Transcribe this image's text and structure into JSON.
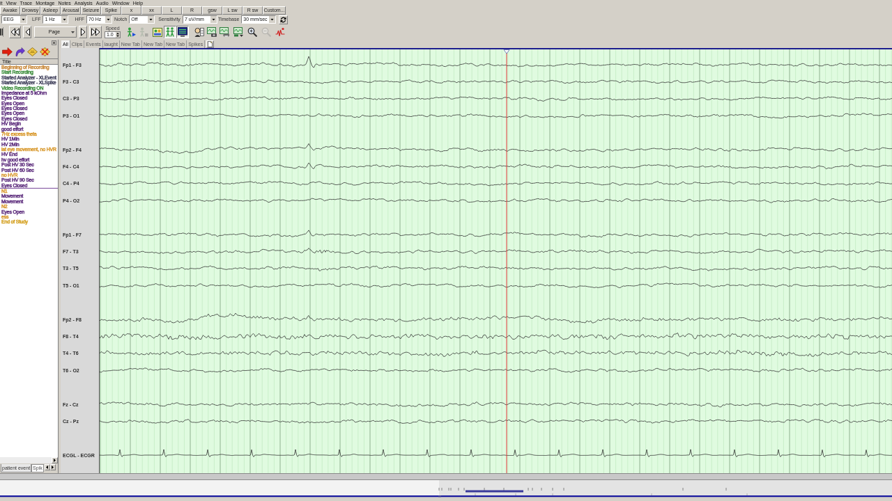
{
  "menu": [
    "it",
    "View",
    "Trace",
    "Montage",
    "Notes",
    "Analysis",
    "Audio",
    "Window",
    "Help"
  ],
  "event_buttons": [
    "Awake",
    "Drowsy",
    "Asleep",
    "Arousal",
    "Seizure",
    "Spike",
    "x",
    "xx",
    "L",
    "R",
    "gsw",
    "L sw",
    "R sw",
    "Custom..."
  ],
  "montage": "EEG",
  "filters": [
    {
      "label": "LFF",
      "value": "1 Hz"
    },
    {
      "label": "HFF",
      "value": "70 Hz"
    },
    {
      "label": "Notch",
      "value": "Off"
    },
    {
      "label": "Sensitivity",
      "value": "7 uV/mm"
    },
    {
      "label": "Timebase",
      "value": "30 mm/sec"
    }
  ],
  "playback": {
    "page": "Page",
    "speed_label": "Speed",
    "speed": "1.0"
  },
  "toolbar_buttons": [
    {
      "pressed": false,
      "disabled": false
    },
    {
      "pressed": false,
      "disabled": true
    },
    {
      "pressed": false,
      "disabled": false
    },
    {
      "pressed": true,
      "disabled": false
    },
    {
      "pressed": true,
      "disabled": false
    },
    {
      "pressed": false,
      "disabled": false
    },
    {
      "pressed": false,
      "disabled": false
    },
    {
      "pressed": false,
      "disabled": false
    },
    {
      "pressed": false,
      "disabled": false
    },
    {
      "pressed": false,
      "disabled": false
    },
    {
      "pressed": false,
      "disabled": true
    },
    {
      "pressed": false,
      "disabled": false
    }
  ],
  "event_panel": {
    "column": "Title",
    "events": [
      {
        "title": "Beginning of Recording",
        "color": "#c98a3c",
        "at_cursor": false
      },
      {
        "title": "Start Recording",
        "color": "#3f8f3f",
        "at_cursor": false
      },
      {
        "title": "Started Analyzer - XLEvent",
        "color": "#44445e",
        "at_cursor": false
      },
      {
        "title": "Started Analyzer - XLSpike",
        "color": "#44445e",
        "at_cursor": false
      },
      {
        "title": "Video Recording ON",
        "color": "#3f8f3f",
        "at_cursor": false
      },
      {
        "title": "Impedance at 5 kOhm",
        "color": "#5c2c7c",
        "at_cursor": false
      },
      {
        "title": "Eyes Closed",
        "color": "#5c2c7c",
        "at_cursor": false
      },
      {
        "title": "Eyes Open",
        "color": "#5c2c7c",
        "at_cursor": false
      },
      {
        "title": "Eyes Closed",
        "color": "#5c2c7c",
        "at_cursor": false
      },
      {
        "title": "Eyes Open",
        "color": "#5c2c7c",
        "at_cursor": false
      },
      {
        "title": "Eyes Closed",
        "color": "#5c2c7c",
        "at_cursor": false
      },
      {
        "title": "HV Begin",
        "color": "#5c2c7c",
        "at_cursor": false
      },
      {
        "title": "good effort",
        "color": "#5c2c7c",
        "at_cursor": false
      },
      {
        "title": "7Hz excess theta",
        "color": "#d8982c",
        "at_cursor": false
      },
      {
        "title": "HV 1Min",
        "color": "#5c2c7c",
        "at_cursor": false
      },
      {
        "title": "HV 2Min",
        "color": "#5c2c7c",
        "at_cursor": false
      },
      {
        "title": "lat eye movement, no HVR",
        "color": "#d8982c",
        "at_cursor": false
      },
      {
        "title": "HV End",
        "color": "#5c2c7c",
        "at_cursor": false
      },
      {
        "title": "hv good effort",
        "color": "#5c2c7c",
        "at_cursor": false
      },
      {
        "title": "Post HV 30 Sec",
        "color": "#5c2c7c",
        "at_cursor": false
      },
      {
        "title": "Post HV 60 Sec",
        "color": "#5c2c7c",
        "at_cursor": false
      },
      {
        "title": "no HVR",
        "color": "#d8982c",
        "at_cursor": false
      },
      {
        "title": "Post HV 90 Sec",
        "color": "#5c2c7c",
        "at_cursor": false
      },
      {
        "title": "Eyes Closed",
        "color": "#5c2c7c",
        "at_cursor": true
      },
      {
        "title": "N1",
        "color": "#d8982c",
        "at_cursor": false
      },
      {
        "title": "Movement",
        "color": "#5c2c7c",
        "at_cursor": false
      },
      {
        "title": "Movement",
        "color": "#5c2c7c",
        "at_cursor": false
      },
      {
        "title": "N2",
        "color": "#d8982c",
        "at_cursor": false
      },
      {
        "title": "Eyes Open",
        "color": "#5c2c7c",
        "at_cursor": false
      },
      {
        "title": "ess",
        "color": "#d8982c",
        "at_cursor": false
      },
      {
        "title": "End of Study",
        "color": "#d4a020",
        "at_cursor": false
      }
    ],
    "tabs": [
      {
        "label": "patient event",
        "selected": true
      },
      {
        "label": "Spik",
        "selected": false
      }
    ]
  },
  "view_tabs": [
    {
      "label": "All",
      "selected": true
    },
    {
      "label": "Clips",
      "selected": false
    },
    {
      "label": "Events",
      "selected": false
    },
    {
      "label": "laught",
      "selected": false
    },
    {
      "label": "New Tab",
      "selected": false
    },
    {
      "label": "New Tab",
      "selected": false
    },
    {
      "label": "New Tab",
      "selected": false
    },
    {
      "label": "Spikes",
      "selected": false
    }
  ],
  "channel_groups": [
    {
      "channels": [
        {
          "label": "Fp1 - F3",
          "kind": "eeg"
        },
        {
          "label": "F3 - C3",
          "kind": "eeg"
        },
        {
          "label": "C3 - P3",
          "kind": "eeg"
        },
        {
          "label": "P3 - O1",
          "kind": "eeg"
        }
      ]
    },
    {
      "channels": [
        {
          "label": "Fp2 - F4",
          "kind": "eeg"
        },
        {
          "label": "F4 - C4",
          "kind": "eeg"
        },
        {
          "label": "C4 - P4",
          "kind": "eeg"
        },
        {
          "label": "P4 - O2",
          "kind": "eeg"
        }
      ]
    },
    {
      "channels": [
        {
          "label": "Fp1 - F7",
          "kind": "eeg"
        },
        {
          "label": "F7 - T3",
          "kind": "eeg"
        },
        {
          "label": "T3 - T5",
          "kind": "eeg"
        },
        {
          "label": "T5 - O1",
          "kind": "eeg"
        }
      ]
    },
    {
      "channels": [
        {
          "label": "Fp2 - F8",
          "kind": "eeg"
        },
        {
          "label": "F8 - T4",
          "kind": "eeg"
        },
        {
          "label": "T4 - T6",
          "kind": "eeg"
        },
        {
          "label": "T6 - O2",
          "kind": "eeg"
        }
      ]
    },
    {
      "channels": [
        {
          "label": "Fz - Cz",
          "kind": "eeg"
        },
        {
          "label": "Cz - Pz",
          "kind": "eeg"
        }
      ]
    },
    {
      "channels": [
        {
          "label": "ECGL - ECGR",
          "kind": "ecg"
        }
      ]
    }
  ]
}
